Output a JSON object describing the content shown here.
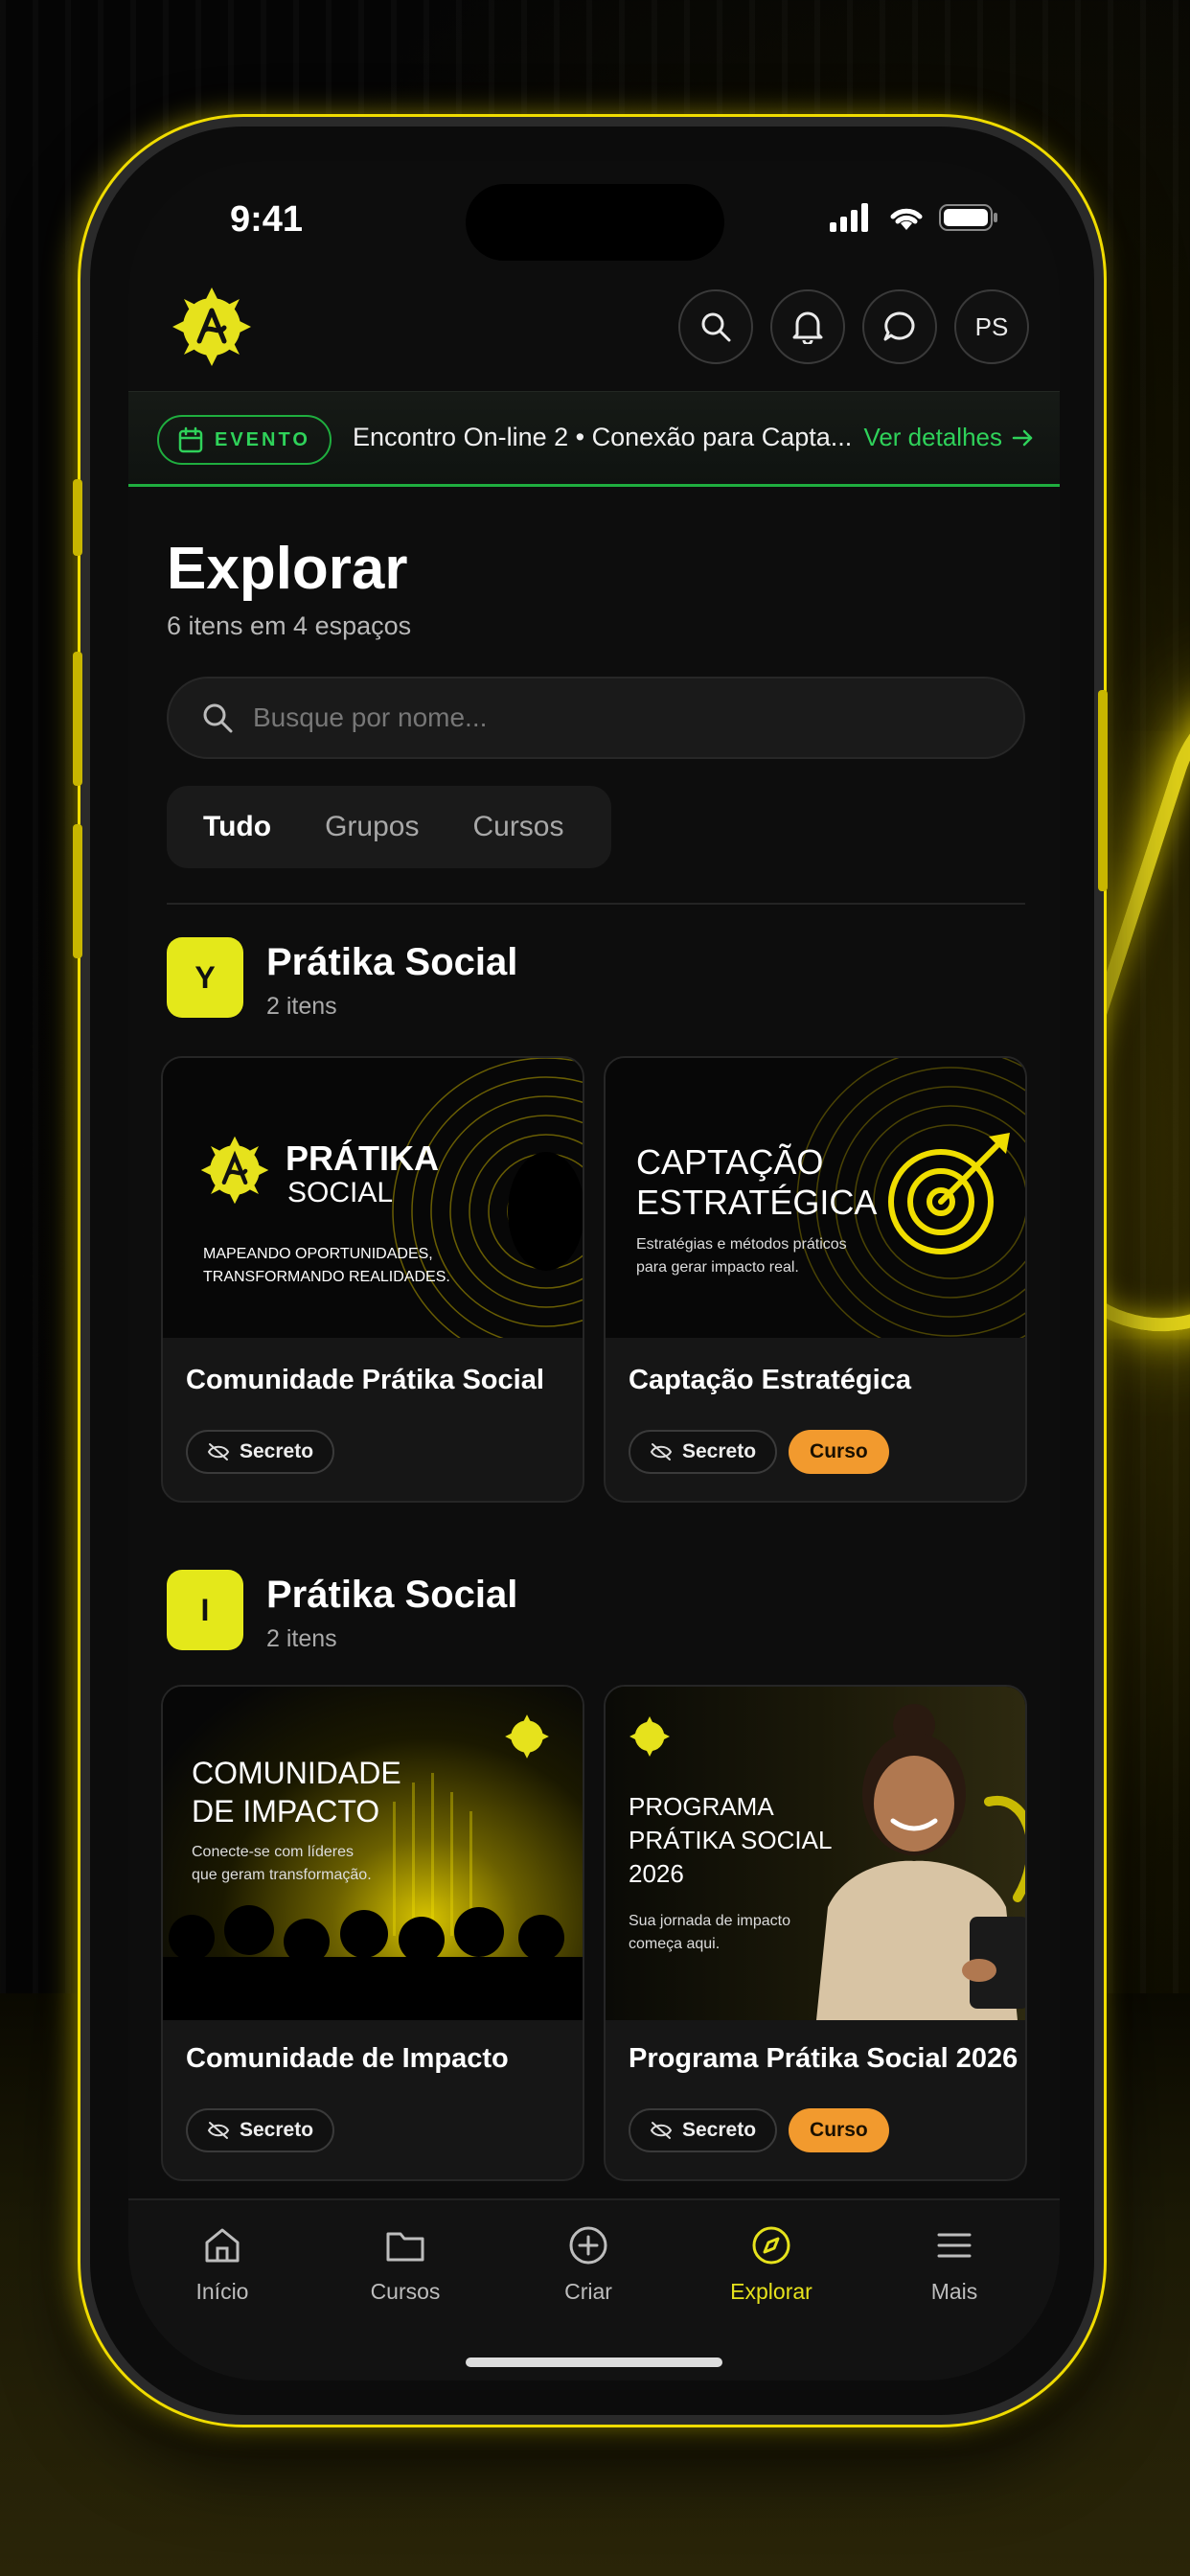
{
  "status_bar": {
    "time": "9:41"
  },
  "header": {
    "avatar_initials": "PS"
  },
  "event": {
    "badge": "EVENTO",
    "text": "Encontro On-line 2 • Conexão para Capta...",
    "link": "Ver detalhes"
  },
  "page": {
    "title": "Explorar",
    "subtitle": "6 itens em 4 espaços"
  },
  "search": {
    "placeholder": "Busque por nome..."
  },
  "tabs": [
    {
      "label": "Tudo",
      "active": true
    },
    {
      "label": "Grupos",
      "active": false
    },
    {
      "label": "Cursos",
      "active": false
    }
  ],
  "sections": [
    {
      "initial": "Y",
      "title": "Prátika Social",
      "count": "2 itens",
      "cards": [
        {
          "title": "Comunidade Prátika Social",
          "thumb": {
            "line1": "PRÁTIKA",
            "line2": "SOCIAL",
            "tagline1": "MAPEANDO OPORTUNIDADES,",
            "tagline2": "TRANSFORMANDO REALIDADES."
          },
          "chips": {
            "secret": "Secreto"
          }
        },
        {
          "title": "Captação Estratégica",
          "thumb": {
            "line1": "CAPTAÇÃO",
            "line2": "ESTRATÉGICA",
            "tagline1": "Estratégias e métodos práticos",
            "tagline2": "para gerar impacto real."
          },
          "chips": {
            "secret": "Secreto",
            "type": "Curso"
          }
        }
      ]
    },
    {
      "initial": "I",
      "title": "Prátika Social",
      "count": "2 itens",
      "cards": [
        {
          "title": "Comunidade de Impacto",
          "thumb": {
            "line1": "COMUNIDADE",
            "line2": "DE IMPACTO",
            "tagline1": "Conecte-se com líderes",
            "tagline2": "que geram transformação."
          },
          "chips": {
            "secret": "Secreto"
          }
        },
        {
          "title": "Programa Prátika Social 2026",
          "thumb": {
            "line1": "PROGRAMA",
            "line2": "PRÁTIKA SOCIAL",
            "line3": "2026",
            "tagline1": "Sua jornada de impacto",
            "tagline2": "começa aqui."
          },
          "chips": {
            "secret": "Secreto",
            "type": "Curso"
          }
        }
      ]
    }
  ],
  "bottom_nav": [
    {
      "label": "Início",
      "icon": "home-icon"
    },
    {
      "label": "Cursos",
      "icon": "folder-icon"
    },
    {
      "label": "Criar",
      "icon": "plus-circle-icon"
    },
    {
      "label": "Explorar",
      "icon": "compass-icon",
      "active": true
    },
    {
      "label": "Mais",
      "icon": "menu-icon"
    }
  ],
  "colors": {
    "accent": "#E6E21C",
    "event_green": "#2FD25A",
    "curso_badge": "#F29A2E",
    "background": "#0D0D0D"
  }
}
